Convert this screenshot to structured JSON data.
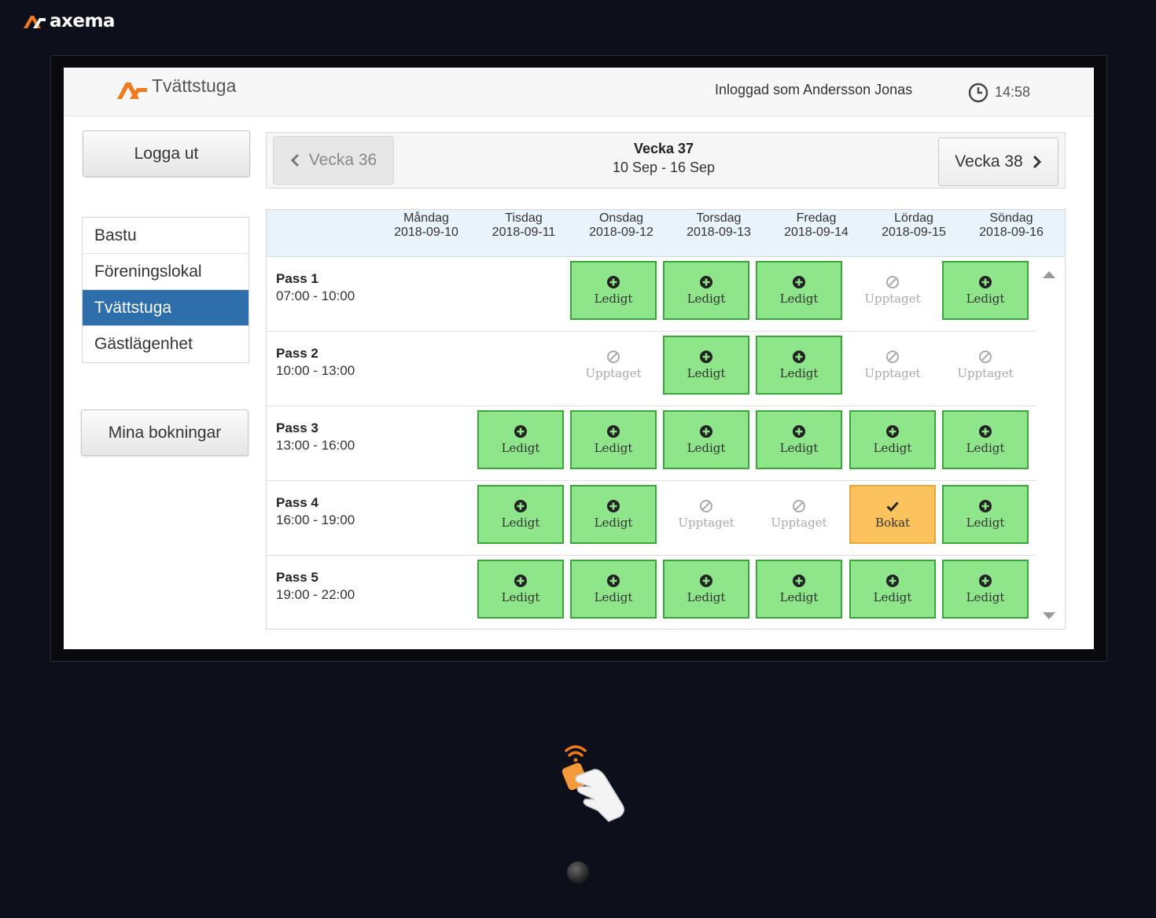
{
  "device": {
    "brand": "axema"
  },
  "header": {
    "app_title": "Tvättstuga",
    "user_label": "Inloggad som Andersson Jonas",
    "time": "14:58"
  },
  "sidebar": {
    "logout_label": "Logga ut",
    "items": [
      {
        "label": "Bastu",
        "active": false
      },
      {
        "label": "Föreningslokal",
        "active": false
      },
      {
        "label": "Tvättstuga",
        "active": true
      },
      {
        "label": "Gästlägenhet",
        "active": false
      }
    ],
    "my_bookings_label": "Mina bokningar"
  },
  "week_nav": {
    "prev_label": "Vecka 36",
    "current_title": "Vecka 37",
    "current_range": "10 Sep - 16 Sep",
    "next_label": "Vecka 38"
  },
  "days": [
    {
      "name": "Måndag",
      "date": "2018-09-10"
    },
    {
      "name": "Tisdag",
      "date": "2018-09-11"
    },
    {
      "name": "Onsdag",
      "date": "2018-09-12"
    },
    {
      "name": "Torsdag",
      "date": "2018-09-13"
    },
    {
      "name": "Fredag",
      "date": "2018-09-14"
    },
    {
      "name": "Lördag",
      "date": "2018-09-15"
    },
    {
      "name": "Söndag",
      "date": "2018-09-16"
    }
  ],
  "status_labels": {
    "free": "Ledigt",
    "taken": "Upptaget",
    "booked": "Bokat"
  },
  "colors": {
    "free": "#8ee58a",
    "free_border": "#3ca43a",
    "booked": "#fcc25e",
    "active_menu": "#2e6fab",
    "brand_orange": "#f07a1e"
  },
  "passes": [
    {
      "name": "Pass 1",
      "time": "07:00 - 10:00",
      "slots": [
        "none",
        "none",
        "free",
        "free",
        "free",
        "taken",
        "free"
      ]
    },
    {
      "name": "Pass 2",
      "time": "10:00 - 13:00",
      "slots": [
        "none",
        "none",
        "taken",
        "free",
        "free",
        "taken",
        "taken"
      ]
    },
    {
      "name": "Pass 3",
      "time": "13:00 - 16:00",
      "slots": [
        "none",
        "free",
        "free",
        "free",
        "free",
        "free",
        "free"
      ]
    },
    {
      "name": "Pass 4",
      "time": "16:00 - 19:00",
      "slots": [
        "none",
        "free",
        "free",
        "taken",
        "taken",
        "booked",
        "free"
      ]
    },
    {
      "name": "Pass 5",
      "time": "19:00 - 22:00",
      "slots": [
        "none",
        "free",
        "free",
        "free",
        "free",
        "free",
        "free"
      ]
    }
  ]
}
